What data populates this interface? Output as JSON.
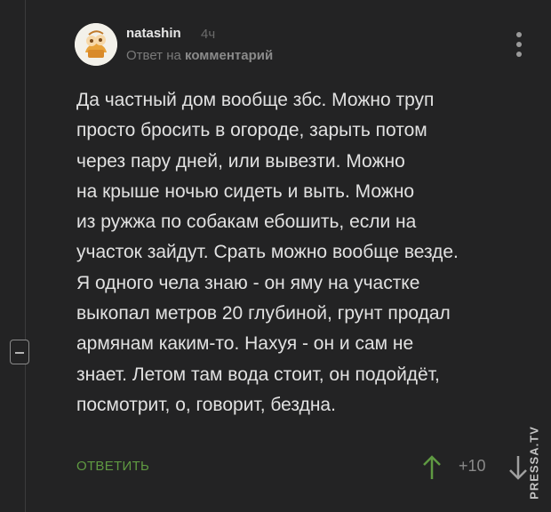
{
  "comment": {
    "author": "natashin",
    "time": "4ч",
    "reply_prefix": "Ответ на",
    "reply_link": "комментарий",
    "text": "Да частный дом вообще збс. Можно труп\nпросто бросить в огороде, зарыть потом\nчерез пару дней, или вывезти. Можно\nна крыше ночью сидеть и выть. Можно\nиз ружжа по собакам ебошить, если на\nучасток зайдут. Срать можно вообще везде.\nЯ одного чела знаю - он яму на участке\nвыкопал метров 20 глубиной, грунт продал\nармянам каким-то. Нахуя - он и сам не\nзнает. Летом там вода стоит, он подойдёт,\nпосмотрит, о, говорит, бездна.",
    "reply_label": "ОТВЕТИТЬ",
    "rating": "+10"
  },
  "watermark": "PRESSA.TV",
  "icons": {
    "avatar": "avatar-cartoon-icon",
    "more": "more-vertical-icon",
    "vote_up": "arrow-up-icon",
    "vote_down": "arrow-down-icon",
    "collapse": "minus-square-icon"
  },
  "colors": {
    "background": "#232324",
    "text": "#e1e1e1",
    "accent_green": "#5f9a42",
    "muted": "#7a7a7a"
  }
}
